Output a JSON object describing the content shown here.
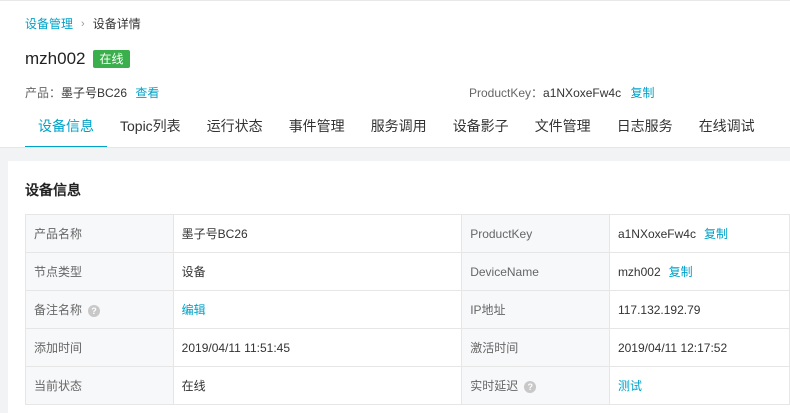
{
  "breadcrumb": {
    "parent": "设备管理",
    "separator": "›",
    "current": "设备详情"
  },
  "device": {
    "name": "mzh002",
    "status": "在线"
  },
  "product_line": {
    "label": "产品：",
    "value": "墨子号BC26",
    "view_link": "查看"
  },
  "product_key_line": {
    "label": "ProductKey：",
    "value": "a1NXoxeFw4c",
    "copy_link": "复制"
  },
  "tabs": [
    {
      "label": "设备信息",
      "active": true
    },
    {
      "label": "Topic列表"
    },
    {
      "label": "运行状态"
    },
    {
      "label": "事件管理"
    },
    {
      "label": "服务调用"
    },
    {
      "label": "设备影子"
    },
    {
      "label": "文件管理"
    },
    {
      "label": "日志服务"
    },
    {
      "label": "在线调试"
    }
  ],
  "section_title": "设备信息",
  "info": {
    "product_name_label": "产品名称",
    "product_name_value": "墨子号BC26",
    "product_key_label": "ProductKey",
    "product_key_value": "a1NXoxeFw4c",
    "node_type_label": "节点类型",
    "node_type_value": "设备",
    "device_name_label": "DeviceName",
    "device_name_value": "mzh002",
    "remark_label": "备注名称",
    "remark_edit": "编辑",
    "ip_label": "IP地址",
    "ip_value": "117.132.192.79",
    "added_label": "添加时间",
    "added_value": "2019/04/11 11:51:45",
    "activated_label": "激活时间",
    "activated_value": "2019/04/11 12:17:52",
    "state_label": "当前状态",
    "state_value": "在线",
    "latency_label": "实时延迟",
    "latency_test": "测试",
    "copy": "复制",
    "help_glyph": "?"
  },
  "colors": {
    "accent": "#00a2c8",
    "online_badge": "#3aaf4b"
  },
  "icons": {
    "help": "help-circle-icon",
    "breadcrumb_separator": "chevron-right-icon"
  }
}
